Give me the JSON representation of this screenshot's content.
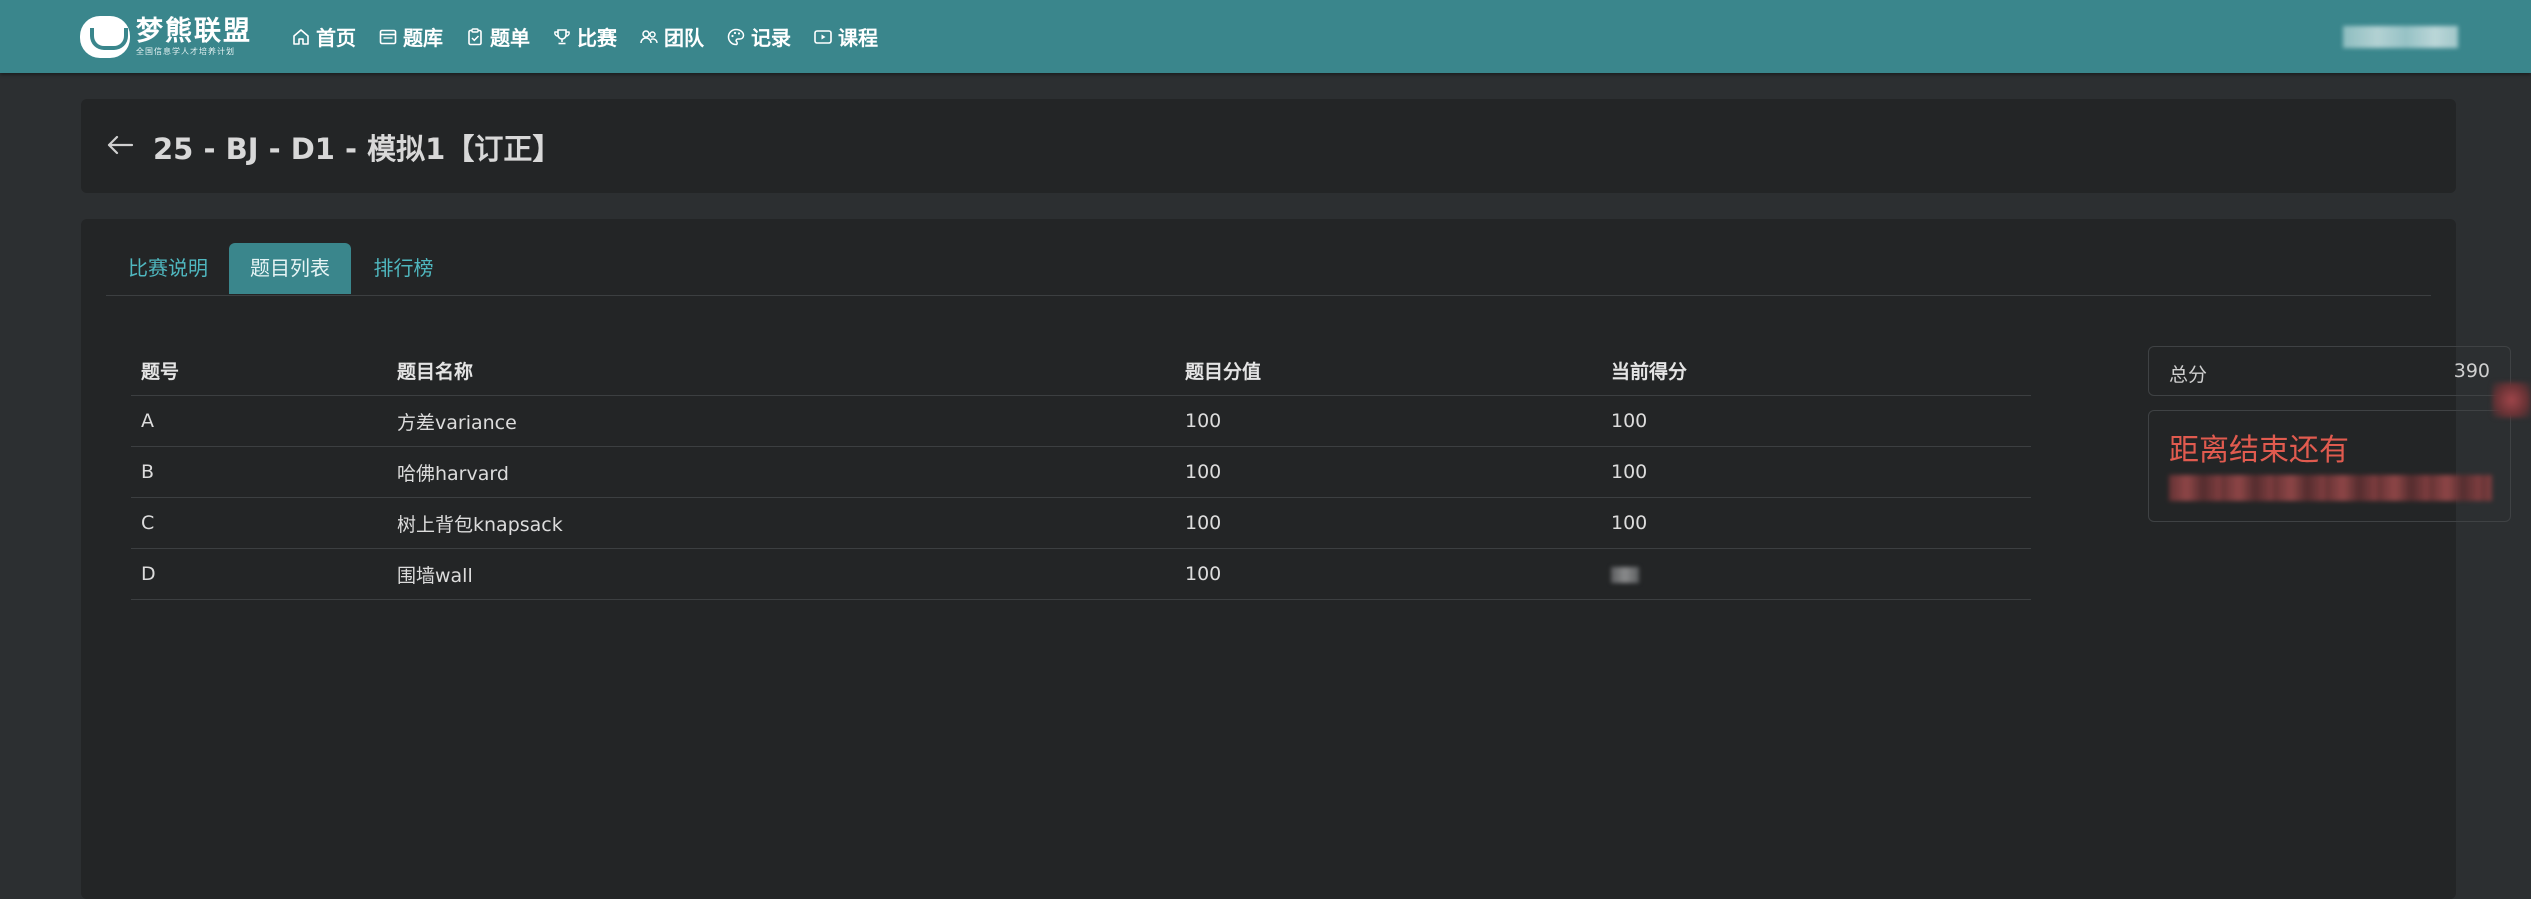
{
  "brand": {
    "title": "梦熊联盟",
    "subtitle": "全国信息学人才培养计划"
  },
  "nav": {
    "items": [
      {
        "label": "首页",
        "icon": "home-icon"
      },
      {
        "label": "题库",
        "icon": "problem-bank-icon"
      },
      {
        "label": "题单",
        "icon": "clipboard-icon"
      },
      {
        "label": "比赛",
        "icon": "trophy-icon"
      },
      {
        "label": "团队",
        "icon": "team-icon"
      },
      {
        "label": "记录",
        "icon": "palette-icon"
      },
      {
        "label": "课程",
        "icon": "video-icon"
      }
    ]
  },
  "contest": {
    "title": "25 - BJ - D1 - 模拟1【订正】"
  },
  "tabs": [
    {
      "label": "比赛说明",
      "active": false
    },
    {
      "label": "题目列表",
      "active": true
    },
    {
      "label": "排行榜",
      "active": false
    }
  ],
  "table": {
    "headers": [
      "题号",
      "题目名称",
      "题目分值",
      "当前得分"
    ],
    "rows": [
      {
        "id": "A",
        "name": "方差variance",
        "points": "100",
        "score": "100"
      },
      {
        "id": "B",
        "name": "哈佛harvard",
        "points": "100",
        "score": "100"
      },
      {
        "id": "C",
        "name": "树上背包knapsack",
        "points": "100",
        "score": "100"
      },
      {
        "id": "D",
        "name": "围墙wall",
        "points": "100",
        "score": ""
      }
    ]
  },
  "summary": {
    "total_label": "总分",
    "total_value": "390",
    "countdown_label": "距离结束还有"
  },
  "colors": {
    "navbar": "#3a868c",
    "card": "#232526",
    "page": "#2c2f31",
    "accent_link": "#4fb7bf",
    "countdown": "#e15b4f"
  }
}
